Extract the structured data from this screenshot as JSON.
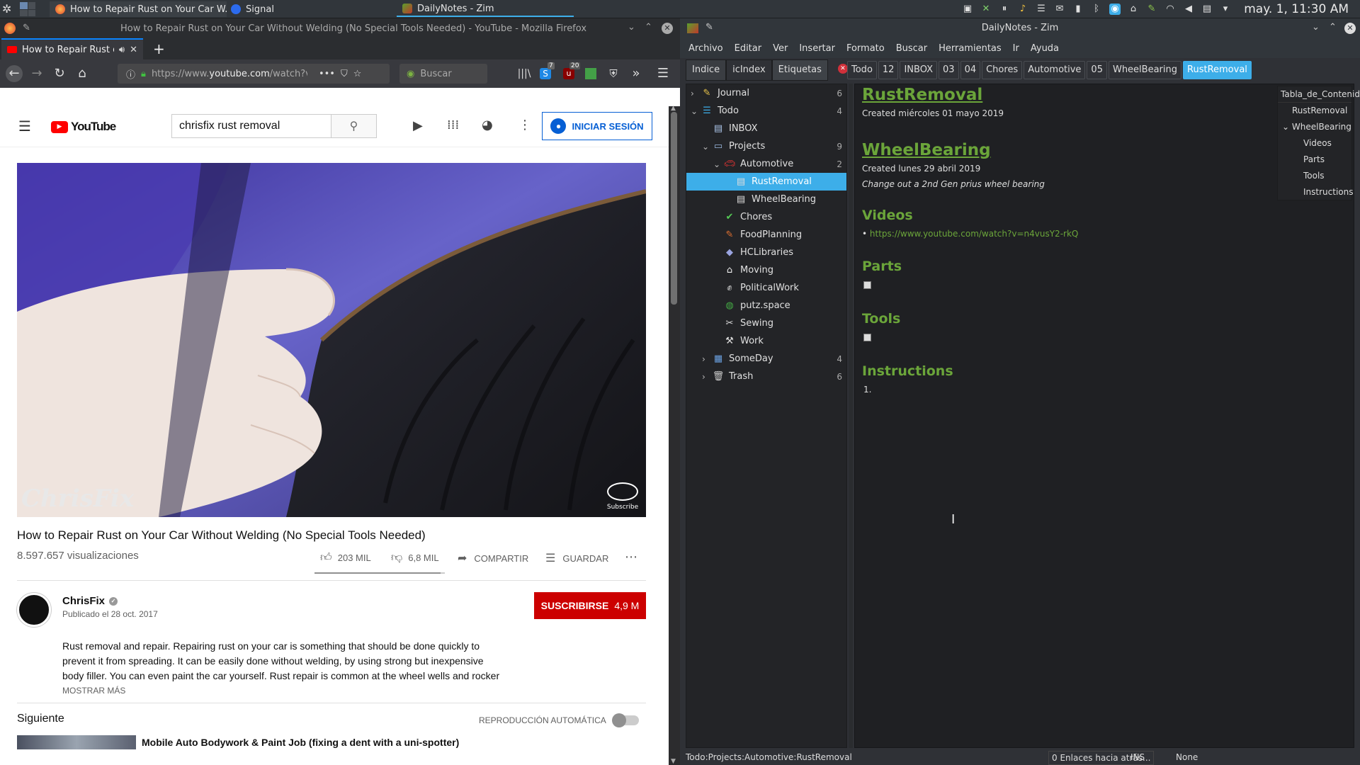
{
  "taskbar": {
    "tasks": [
      {
        "label": "How to Repair Rust on Your Car W..."
      },
      {
        "label": "Signal"
      },
      {
        "label": "DailyNotes - Zim"
      }
    ],
    "clock": "may. 1, 11:30 AM"
  },
  "firefox": {
    "window_title": "How to Repair Rust on Your Car Without Welding (No Special Tools Needed) - YouTube - Mozilla Firefox",
    "tab_label": "How to Repair Rust on Y",
    "url_prefix": "https://www.",
    "url_host": "youtube.com",
    "url_rest": "/watch?v",
    "search_placeholder": "Buscar",
    "badge_s": "7",
    "badge_u": "20"
  },
  "youtube": {
    "logo": "YouTube",
    "search_value": "chrisfix rust removal",
    "signin_label": "INICIAR SESIÓN",
    "video_watermark": "ChrisFix",
    "video_subscribe": "Subscribe",
    "video_title": "How to Repair Rust on Your Car Without Welding (No Special Tools Needed)",
    "views": "8.597.657 visualizaciones",
    "likes": "203 MIL",
    "dislikes": "6,8 MIL",
    "share_label": "COMPARTIR",
    "save_label": "GUARDAR",
    "like_ratio": 0.97,
    "channel_name": "ChrisFix",
    "published": "Publicado el 28 oct. 2017",
    "subscribe_label": "SUSCRIBIRSE",
    "subscriber_count": "4,9 M",
    "description": "Rust removal and repair. Repairing rust on your car is something that should be done quickly to prevent it from spreading. It can be easily done without welding, by using strong but inexpensive body filler. You can even paint the car yourself. Rust repair is common at the wheel wells and rocker",
    "show_more": "MOSTRAR MÁS",
    "up_next_label": "Siguiente",
    "autoplay_label": "REPRODUCCIÓN AUTOMÁTICA",
    "next_video_title": "Mobile Auto Bodywork & Paint Job (fixing a dent with a uni-spotter)"
  },
  "zim": {
    "window_title": "DailyNotes - Zim",
    "menu": [
      "Archivo",
      "Editar",
      "Ver",
      "Insertar",
      "Formato",
      "Buscar",
      "Herramientas",
      "Ir",
      "Ayuda"
    ],
    "side_tabs": [
      "Indice",
      "icIndex",
      "Etiquetas"
    ],
    "pathbar": [
      "Todo",
      "12",
      "INBOX",
      "03",
      "04",
      "Chores",
      "Automotive",
      "05",
      "WheelBearing",
      "RustRemoval"
    ],
    "tree": [
      {
        "label": "Journal",
        "count": "6"
      },
      {
        "label": "Todo",
        "count": "4"
      },
      {
        "label": "INBOX",
        "count": ""
      },
      {
        "label": "Projects",
        "count": "9"
      },
      {
        "label": "Automotive",
        "count": "2"
      },
      {
        "label": "RustRemoval",
        "count": ""
      },
      {
        "label": "WheelBearing",
        "count": ""
      },
      {
        "label": "Chores",
        "count": ""
      },
      {
        "label": "FoodPlanning",
        "count": ""
      },
      {
        "label": "HCLibraries",
        "count": ""
      },
      {
        "label": "Moving",
        "count": ""
      },
      {
        "label": "PoliticalWork",
        "count": ""
      },
      {
        "label": "putz.space",
        "count": ""
      },
      {
        "label": "Sewing",
        "count": ""
      },
      {
        "label": "Work",
        "count": ""
      },
      {
        "label": "SomeDay",
        "count": "4"
      },
      {
        "label": "Trash",
        "count": "6"
      }
    ],
    "page": {
      "h1": "RustRemoval",
      "created1": "Created miércoles 01 mayo 2019",
      "h2": "WheelBearing",
      "created2": "Created lunes 29 abril 2019",
      "desc": "Change out a 2nd Gen prius wheel bearing",
      "videos_h": "Videos",
      "video_link": "https://www.youtube.com/watch?v=n4vusY2-rkQ",
      "parts_h": "Parts",
      "tools_h": "Tools",
      "instructions_h": "Instructions",
      "list_item": "1."
    },
    "toc": [
      "Tabla_de_Contenido",
      "RustRemoval",
      "WheelBearing",
      "Videos",
      "Parts",
      "Tools",
      "Instructions"
    ],
    "status": {
      "path": "Todo:Projects:Automotive:RustRemoval",
      "backlinks": "0 Enlaces hacia atrás...",
      "mode": "INS",
      "style": "None"
    }
  }
}
